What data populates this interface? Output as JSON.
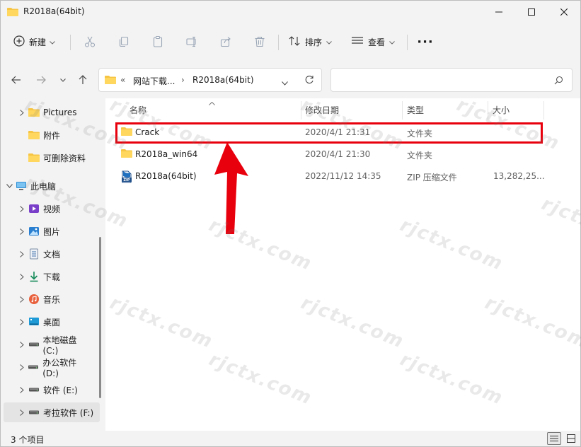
{
  "window": {
    "title": "R2018a(64bit)"
  },
  "toolbar": {
    "new_label": "新建",
    "sort_label": "排序",
    "view_label": "查看",
    "more_label": "···"
  },
  "address": {
    "overflow": "«",
    "crumbs": [
      "网站下载...",
      "R2018a(64bit)"
    ],
    "search_placeholder": ""
  },
  "nav": {
    "items": [
      {
        "label": "Pictures",
        "icon": "folder-icon"
      },
      {
        "label": "附件",
        "icon": "folder-icon"
      },
      {
        "label": "可删除资料",
        "icon": "folder-icon"
      },
      {
        "label": "此电脑",
        "icon": "computer-icon"
      },
      {
        "label": "视频",
        "icon": "video-icon"
      },
      {
        "label": "图片",
        "icon": "image-icon"
      },
      {
        "label": "文档",
        "icon": "document-icon"
      },
      {
        "label": "下载",
        "icon": "download-icon"
      },
      {
        "label": "音乐",
        "icon": "music-icon"
      },
      {
        "label": "桌面",
        "icon": "desktop-icon"
      },
      {
        "label": "本地磁盘 (C:)",
        "icon": "drive-icon"
      },
      {
        "label": "办公软件 (D:)",
        "icon": "drive-icon"
      },
      {
        "label": "软件 (E:)",
        "icon": "drive-icon"
      },
      {
        "label": "考拉软件 (F:)",
        "icon": "drive-icon"
      }
    ]
  },
  "columns": {
    "name": "名称",
    "modified": "修改日期",
    "type": "类型",
    "size": "大小"
  },
  "files": [
    {
      "name": "Crack",
      "modified": "2020/4/1 21:31",
      "type": "文件夹",
      "size": "",
      "icon": "folder-icon"
    },
    {
      "name": "R2018a_win64",
      "modified": "2020/4/1 21:30",
      "type": "文件夹",
      "size": "",
      "icon": "folder-icon"
    },
    {
      "name": "R2018a(64bit)",
      "modified": "2022/11/12 14:35",
      "type": "ZIP 压缩文件",
      "size": "13,282,25...",
      "icon": "zip-icon"
    }
  ],
  "status": {
    "count": "3 个项目"
  },
  "colors": {
    "highlight": "#e8000d",
    "folder": "#f6c544",
    "accent": "#0067c0"
  },
  "watermark": "rjctx.com"
}
